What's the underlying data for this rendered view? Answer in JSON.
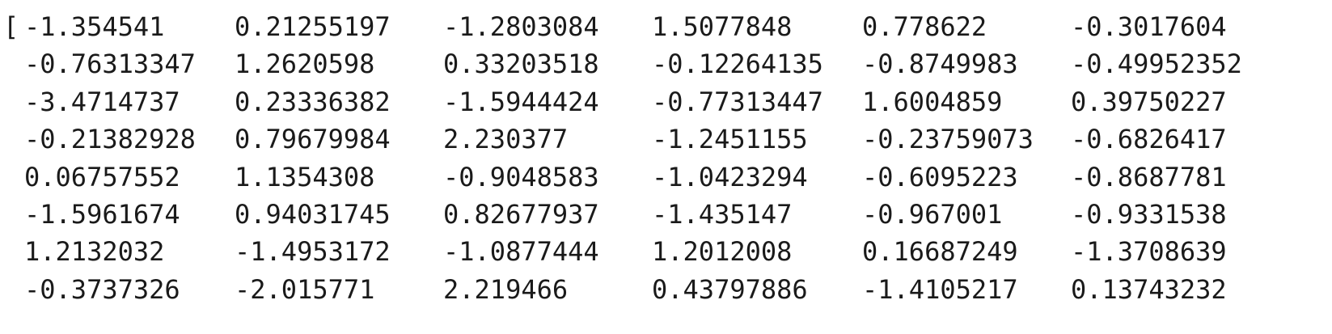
{
  "output": {
    "open_bracket": "[",
    "rows": [
      [
        "-1.354541",
        "0.21255197",
        "-1.2803084",
        "1.5077848",
        "0.778622",
        "-0.3017604"
      ],
      [
        "-0.76313347",
        "1.2620598",
        "0.33203518",
        "-0.12264135",
        "-0.8749983",
        "-0.49952352"
      ],
      [
        "-3.4714737",
        "0.23336382",
        "-1.5944424",
        "-0.77313447",
        "1.6004859",
        "0.39750227"
      ],
      [
        "-0.21382928",
        "0.79679984",
        "2.230377",
        "-1.2451155",
        "-0.23759073",
        "-0.6826417"
      ],
      [
        "0.06757552",
        "1.1354308",
        "-0.9048583",
        "-1.0423294",
        "-0.6095223",
        "-0.8687781"
      ],
      [
        "-1.5961674",
        "0.94031745",
        "0.82677937",
        "-1.435147",
        "-0.967001",
        "-0.9331538"
      ],
      [
        "1.2132032",
        "-1.4953172",
        "-1.0877444",
        "1.2012008",
        "0.16687249",
        "-1.3708639"
      ],
      [
        "-0.3737326",
        "-2.015771",
        "2.219466",
        "0.43797886",
        "-1.4105217",
        "0.13743232"
      ]
    ]
  }
}
